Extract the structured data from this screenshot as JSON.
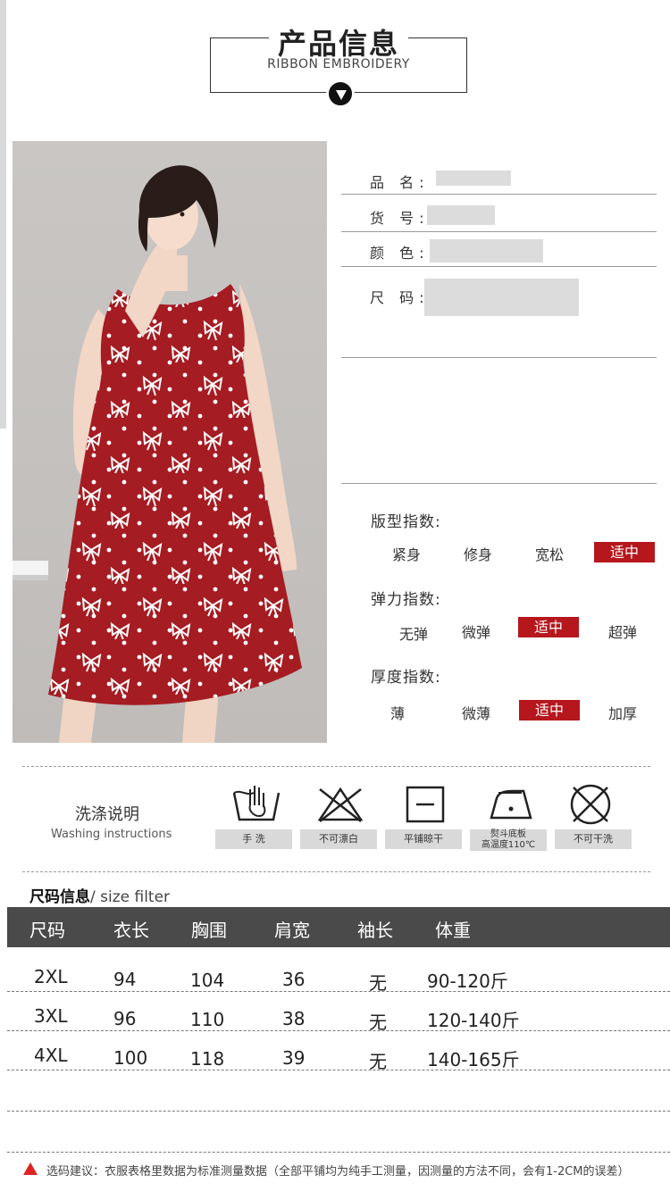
{
  "header": {
    "title": "产品信息",
    "subtitle": "RIBBON EMBROIDERY"
  },
  "info": [
    {
      "label": "品 名:"
    },
    {
      "label": "货 号:"
    },
    {
      "label": "颜 色:"
    },
    {
      "label": "尺 码:"
    }
  ],
  "indices": {
    "fit": {
      "title": "版型指数:",
      "options": [
        "紧身",
        "修身",
        "宽松",
        "适中"
      ],
      "selected": "适中"
    },
    "stretch": {
      "title": "弹力指数:",
      "options": [
        "无弹",
        "微弹",
        "适中",
        "超弹"
      ],
      "selected": "适中"
    },
    "thickness": {
      "title": "厚度指数:",
      "options": [
        "薄",
        "微薄",
        "适中",
        "加厚"
      ],
      "selected": "适中"
    }
  },
  "washing": {
    "title_cn": "洗涤说明",
    "title_en": "Washing instructions",
    "items": [
      {
        "icon": "hand-wash-icon",
        "label": "手 洗"
      },
      {
        "icon": "no-bleach-icon",
        "label": "不可漂白"
      },
      {
        "icon": "dry-flat-icon",
        "label": "平铺晾干"
      },
      {
        "icon": "iron-icon",
        "label_line1": "熨斗底板",
        "label_line2": "高温度110℃"
      },
      {
        "icon": "no-dry-clean-icon",
        "label": "不可干洗"
      }
    ]
  },
  "size_table": {
    "title_bold": "尺码信息",
    "title_rest": "/ size filter",
    "headers": [
      "尺码",
      "衣长",
      "胸围",
      "肩宽",
      "袖长",
      "体重"
    ],
    "rows": [
      [
        "2XL",
        "94",
        "104",
        "36",
        "无",
        "90-120斤"
      ],
      [
        "3XL",
        "96",
        "110",
        "38",
        "无",
        "120-140斤"
      ],
      [
        "4XL",
        "100",
        "118",
        "39",
        "无",
        "140-165斤"
      ]
    ]
  },
  "note": "选码建议：衣服表格里数据为标准测量数据（全部平铺均为纯手工测量，因测量的方法不同，会有1-2CM的误差）",
  "colors": {
    "accent": "#b5171d",
    "dress": "#a51c22",
    "table_header": "#4a4a4a"
  }
}
